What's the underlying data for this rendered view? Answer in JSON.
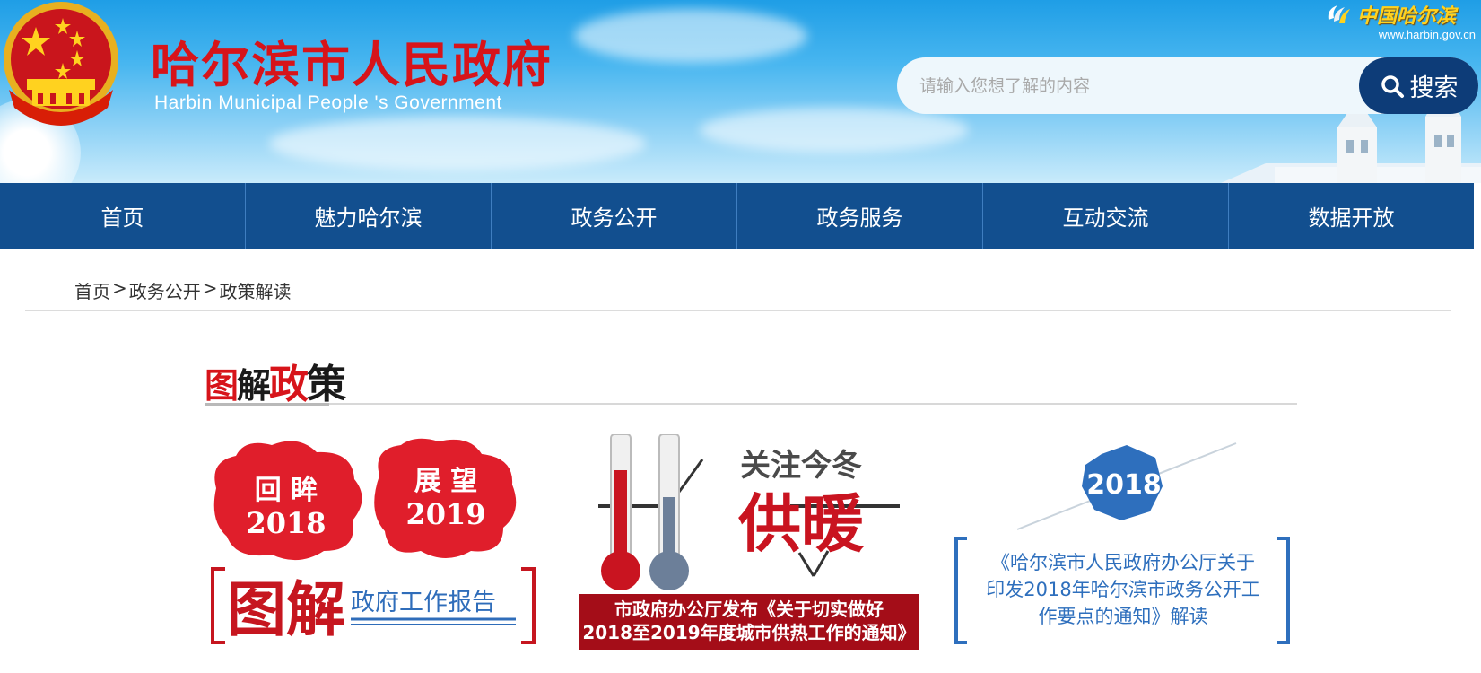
{
  "header": {
    "site_title": "哈尔滨市人民政府",
    "site_subtitle": "Harbin Municipal People 's Government",
    "brand_cn": "中国哈尔滨",
    "brand_url": "www.harbin.gov.cn"
  },
  "search": {
    "placeholder": "请输入您想了解的内容",
    "button_label": "搜索"
  },
  "nav": {
    "items": [
      {
        "label": "首页"
      },
      {
        "label": "魅力哈尔滨"
      },
      {
        "label": "政务公开"
      },
      {
        "label": "政务服务"
      },
      {
        "label": "互动交流"
      },
      {
        "label": "数据开放"
      }
    ]
  },
  "breadcrumb": {
    "items": [
      "首页",
      "政务公开",
      "政策解读"
    ],
    "separator": ">"
  },
  "section": {
    "title_part1": "图",
    "title_part2": "解",
    "title_part3": "政",
    "title_part4": "策"
  },
  "cards": [
    {
      "line1_left": "回  眸",
      "year_left": "2018",
      "line1_right": "展  望",
      "year_right": "2019",
      "tag": "图解",
      "subtitle": "政府工作报告"
    },
    {
      "headline1": "关注今冬",
      "headline2": "供暖",
      "caption1": "市政府办公厅发布《关于切实做好",
      "caption2": "2018至2019年度城市供热工作的通知》"
    },
    {
      "year": "2018",
      "text1": "《哈尔滨市人民政府办公厅关于",
      "text2": "印发2018年哈尔滨市政务公开工",
      "text3": "作要点的通知》解读"
    }
  ],
  "colors": {
    "nav_bg": "#124f8f",
    "title_red": "#d7141a",
    "search_btn": "#0d3c78",
    "brand_yellow": "#ffd21f"
  }
}
